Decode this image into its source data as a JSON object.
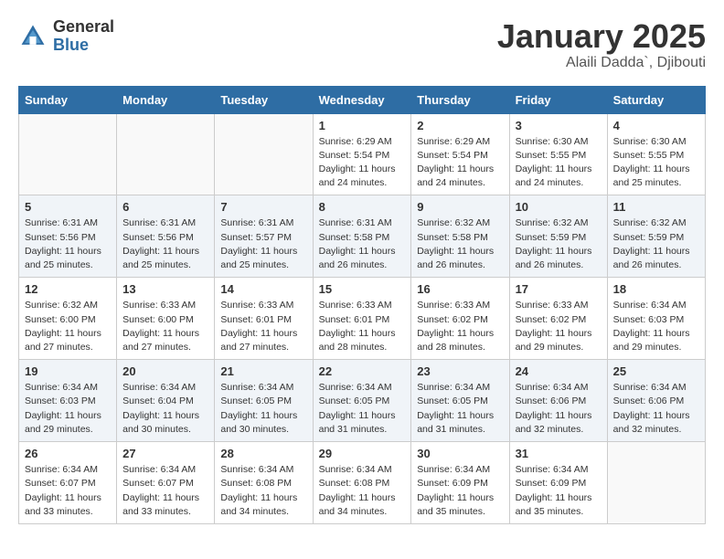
{
  "header": {
    "logo_general": "General",
    "logo_blue": "Blue",
    "month": "January 2025",
    "location": "Alaili Dadda`, Djibouti"
  },
  "days_of_week": [
    "Sunday",
    "Monday",
    "Tuesday",
    "Wednesday",
    "Thursday",
    "Friday",
    "Saturday"
  ],
  "weeks": [
    [
      {
        "day": "",
        "info": ""
      },
      {
        "day": "",
        "info": ""
      },
      {
        "day": "",
        "info": ""
      },
      {
        "day": "1",
        "info": "Sunrise: 6:29 AM\nSunset: 5:54 PM\nDaylight: 11 hours and 24 minutes."
      },
      {
        "day": "2",
        "info": "Sunrise: 6:29 AM\nSunset: 5:54 PM\nDaylight: 11 hours and 24 minutes."
      },
      {
        "day": "3",
        "info": "Sunrise: 6:30 AM\nSunset: 5:55 PM\nDaylight: 11 hours and 24 minutes."
      },
      {
        "day": "4",
        "info": "Sunrise: 6:30 AM\nSunset: 5:55 PM\nDaylight: 11 hours and 25 minutes."
      }
    ],
    [
      {
        "day": "5",
        "info": "Sunrise: 6:31 AM\nSunset: 5:56 PM\nDaylight: 11 hours and 25 minutes."
      },
      {
        "day": "6",
        "info": "Sunrise: 6:31 AM\nSunset: 5:56 PM\nDaylight: 11 hours and 25 minutes."
      },
      {
        "day": "7",
        "info": "Sunrise: 6:31 AM\nSunset: 5:57 PM\nDaylight: 11 hours and 25 minutes."
      },
      {
        "day": "8",
        "info": "Sunrise: 6:31 AM\nSunset: 5:58 PM\nDaylight: 11 hours and 26 minutes."
      },
      {
        "day": "9",
        "info": "Sunrise: 6:32 AM\nSunset: 5:58 PM\nDaylight: 11 hours and 26 minutes."
      },
      {
        "day": "10",
        "info": "Sunrise: 6:32 AM\nSunset: 5:59 PM\nDaylight: 11 hours and 26 minutes."
      },
      {
        "day": "11",
        "info": "Sunrise: 6:32 AM\nSunset: 5:59 PM\nDaylight: 11 hours and 26 minutes."
      }
    ],
    [
      {
        "day": "12",
        "info": "Sunrise: 6:32 AM\nSunset: 6:00 PM\nDaylight: 11 hours and 27 minutes."
      },
      {
        "day": "13",
        "info": "Sunrise: 6:33 AM\nSunset: 6:00 PM\nDaylight: 11 hours and 27 minutes."
      },
      {
        "day": "14",
        "info": "Sunrise: 6:33 AM\nSunset: 6:01 PM\nDaylight: 11 hours and 27 minutes."
      },
      {
        "day": "15",
        "info": "Sunrise: 6:33 AM\nSunset: 6:01 PM\nDaylight: 11 hours and 28 minutes."
      },
      {
        "day": "16",
        "info": "Sunrise: 6:33 AM\nSunset: 6:02 PM\nDaylight: 11 hours and 28 minutes."
      },
      {
        "day": "17",
        "info": "Sunrise: 6:33 AM\nSunset: 6:02 PM\nDaylight: 11 hours and 29 minutes."
      },
      {
        "day": "18",
        "info": "Sunrise: 6:34 AM\nSunset: 6:03 PM\nDaylight: 11 hours and 29 minutes."
      }
    ],
    [
      {
        "day": "19",
        "info": "Sunrise: 6:34 AM\nSunset: 6:03 PM\nDaylight: 11 hours and 29 minutes."
      },
      {
        "day": "20",
        "info": "Sunrise: 6:34 AM\nSunset: 6:04 PM\nDaylight: 11 hours and 30 minutes."
      },
      {
        "day": "21",
        "info": "Sunrise: 6:34 AM\nSunset: 6:05 PM\nDaylight: 11 hours and 30 minutes."
      },
      {
        "day": "22",
        "info": "Sunrise: 6:34 AM\nSunset: 6:05 PM\nDaylight: 11 hours and 31 minutes."
      },
      {
        "day": "23",
        "info": "Sunrise: 6:34 AM\nSunset: 6:05 PM\nDaylight: 11 hours and 31 minutes."
      },
      {
        "day": "24",
        "info": "Sunrise: 6:34 AM\nSunset: 6:06 PM\nDaylight: 11 hours and 32 minutes."
      },
      {
        "day": "25",
        "info": "Sunrise: 6:34 AM\nSunset: 6:06 PM\nDaylight: 11 hours and 32 minutes."
      }
    ],
    [
      {
        "day": "26",
        "info": "Sunrise: 6:34 AM\nSunset: 6:07 PM\nDaylight: 11 hours and 33 minutes."
      },
      {
        "day": "27",
        "info": "Sunrise: 6:34 AM\nSunset: 6:07 PM\nDaylight: 11 hours and 33 minutes."
      },
      {
        "day": "28",
        "info": "Sunrise: 6:34 AM\nSunset: 6:08 PM\nDaylight: 11 hours and 34 minutes."
      },
      {
        "day": "29",
        "info": "Sunrise: 6:34 AM\nSunset: 6:08 PM\nDaylight: 11 hours and 34 minutes."
      },
      {
        "day": "30",
        "info": "Sunrise: 6:34 AM\nSunset: 6:09 PM\nDaylight: 11 hours and 35 minutes."
      },
      {
        "day": "31",
        "info": "Sunrise: 6:34 AM\nSunset: 6:09 PM\nDaylight: 11 hours and 35 minutes."
      },
      {
        "day": "",
        "info": ""
      }
    ]
  ]
}
